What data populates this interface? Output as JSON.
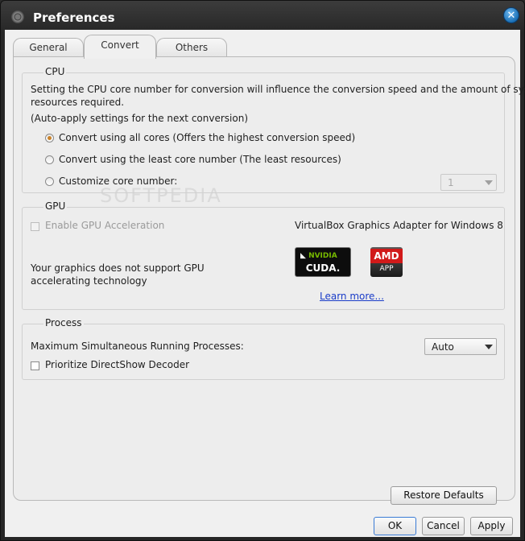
{
  "window": {
    "title": "Preferences",
    "close_glyph": "✕"
  },
  "tabs": [
    {
      "label": "General",
      "active": false
    },
    {
      "label": "Convert",
      "active": true
    },
    {
      "label": "Others",
      "active": false
    }
  ],
  "cpu": {
    "title": "CPU",
    "description_line1": "Setting the CPU core number for conversion will influence the conversion speed and the amount of system",
    "description_line2": "resources required.",
    "auto_apply_note": "(Auto-apply settings for the next conversion)",
    "options": [
      {
        "label": "Convert using all cores (Offers the highest conversion speed)",
        "checked": true
      },
      {
        "label": "Convert using the least core number (The least resources)",
        "checked": false
      },
      {
        "label": "Customize core number:",
        "checked": false
      }
    ],
    "core_number": {
      "value": "1",
      "enabled": false
    }
  },
  "gpu": {
    "title": "GPU",
    "enable_label": "Enable GPU Acceleration",
    "enable_checked": false,
    "adapter_name": "VirtualBox Graphics Adapter for Windows 8",
    "not_supported_line1": "Your graphics does not support GPU",
    "not_supported_line2": "accelerating technology",
    "nvidia_line1_brand": "NVIDIA",
    "nvidia_line2": "CUDA.",
    "amd_line1": "AMD",
    "amd_line2": "APP",
    "learn_more": "Learn more..."
  },
  "process": {
    "title": "Process",
    "max_label": "Maximum Simultaneous Running Processes:",
    "max_value": "Auto",
    "directshow_label": "Prioritize DirectShow Decoder",
    "directshow_checked": false
  },
  "watermark": "SOFTPEDIA",
  "buttons": {
    "restore": "Restore Defaults",
    "ok": "OK",
    "cancel": "Cancel",
    "apply": "Apply"
  },
  "colors": {
    "accent_radio": "#c9822a",
    "link": "#1a3cc8",
    "nvidia_green": "#76b900",
    "amd_red": "#d11a1a"
  }
}
